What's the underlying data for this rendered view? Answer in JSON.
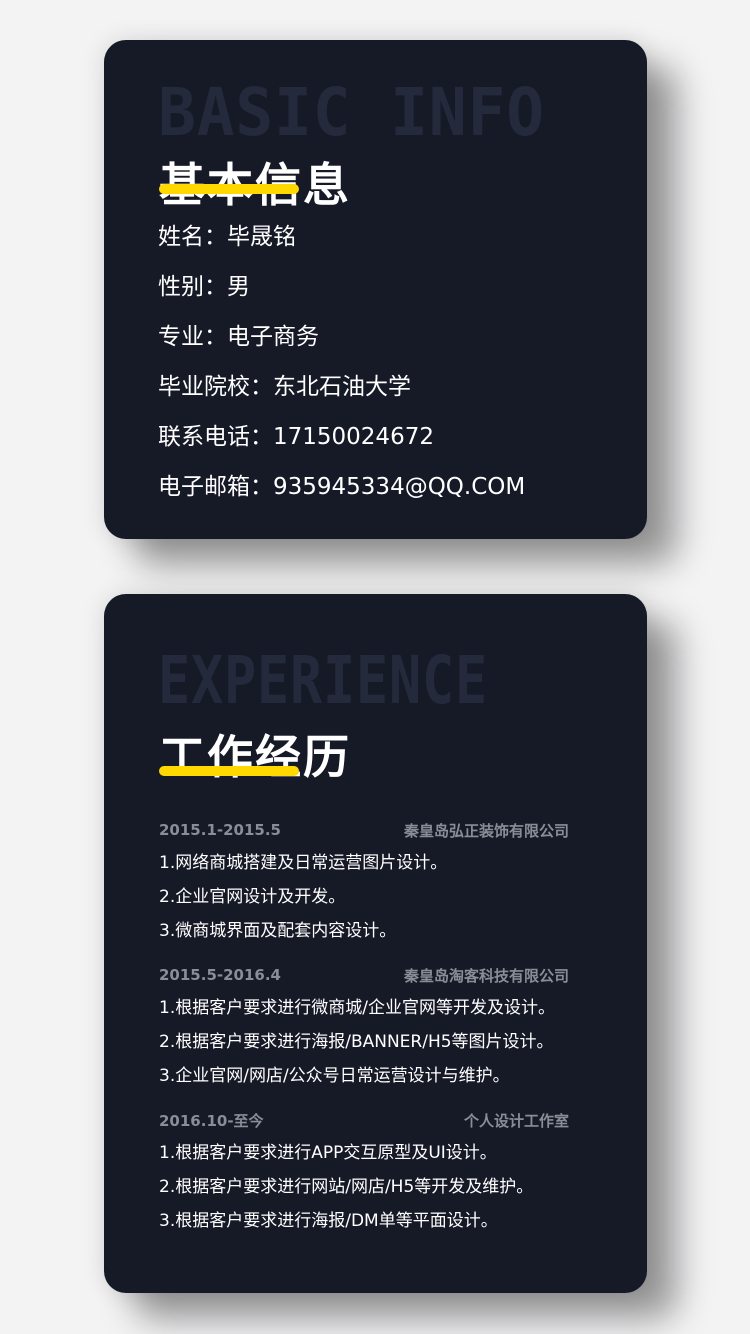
{
  "basic_info": {
    "watermark": "BASIC INFO",
    "title": "基本信息",
    "rows": [
      "姓名：毕晟铭",
      "性别：男",
      "专业：电子商务",
      "毕业院校：东北石油大学",
      "联系电话：17150024672",
      "电子邮箱：935945334@QQ.COM"
    ]
  },
  "experience": {
    "watermark": "EXPERIENCE",
    "title": "工作经历",
    "entries": [
      {
        "period": "2015.1-2015.5",
        "company": "秦皇岛弘正装饰有限公司",
        "items": [
          "1.网络商城搭建及日常运营图片设计。",
          "2.企业官网设计及开发。",
          "3.微商城界面及配套内容设计。"
        ]
      },
      {
        "period": "2015.5-2016.4",
        "company": "秦皇岛淘客科技有限公司",
        "items": [
          "1.根据客户要求进行微商城/企业官网等开发及设计。",
          "2.根据客户要求进行海报/BANNER/H5等图片设计。",
          "3.企业官网/网店/公众号日常运营设计与维护。"
        ]
      },
      {
        "period": "2016.10-至今",
        "company": "个人设计工作室",
        "items": [
          "1.根据客户要求进行APP交互原型及UI设计。",
          "2.根据客户要求进行网站/网店/H5等开发及维护。",
          "3.根据客户要求进行海报/DM单等平面设计。"
        ]
      }
    ]
  },
  "colors": {
    "card_background": "#161a27",
    "accent_yellow": "#ffd800",
    "watermark": "#242a3c",
    "meta_gray": "#8a8d96",
    "page_background": "#f3f3f4"
  }
}
